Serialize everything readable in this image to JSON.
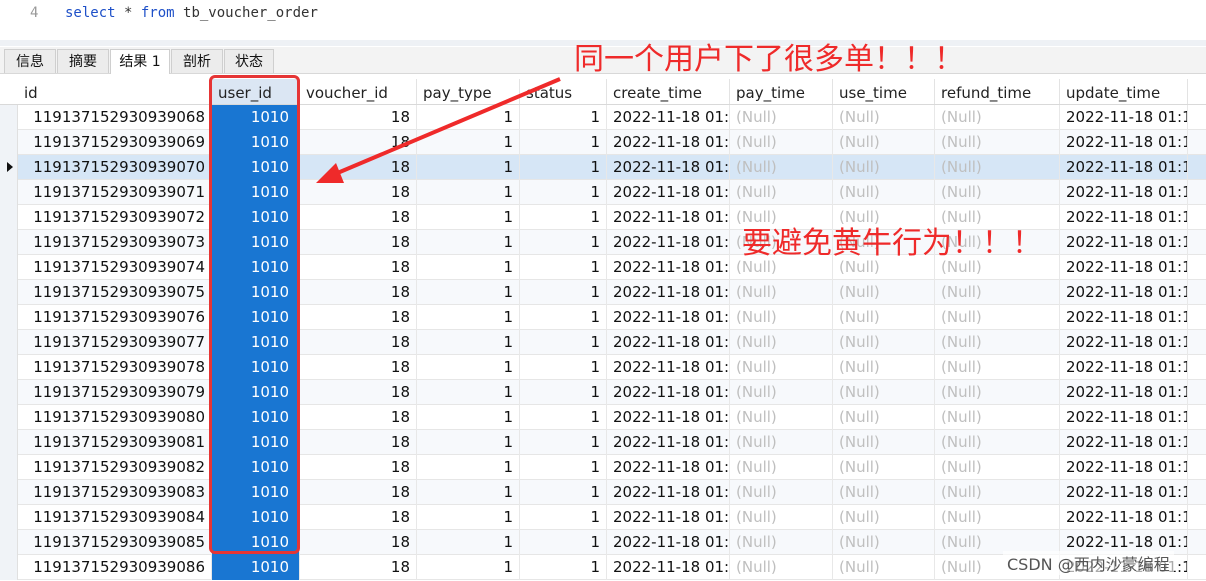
{
  "editor": {
    "line_number": "4",
    "sql_keyword_select": "select",
    "sql_star": " * ",
    "sql_keyword_from": "from",
    "sql_table": " tb_voucher_order"
  },
  "tabs": [
    {
      "label": "信息"
    },
    {
      "label": "摘要"
    },
    {
      "label": "结果 1",
      "active": true
    },
    {
      "label": "剖析"
    },
    {
      "label": "状态"
    }
  ],
  "table": {
    "columns": [
      "id",
      "user_id",
      "voucher_id",
      "pay_type",
      "status",
      "create_time",
      "pay_time",
      "use_time",
      "refund_time",
      "update_time"
    ],
    "selected_column": "user_id",
    "current_row_index": 2,
    "rows": [
      [
        "119137152930939068",
        "1010",
        "18",
        "1",
        "1",
        "2022-11-18 01:",
        "(Null)",
        "(Null)",
        "(Null)",
        "2022-11-18 01:1"
      ],
      [
        "119137152930939069",
        "1010",
        "18",
        "1",
        "1",
        "2022-11-18 01:",
        "(Null)",
        "(Null)",
        "(Null)",
        "2022-11-18 01:1"
      ],
      [
        "119137152930939070",
        "1010",
        "18",
        "1",
        "1",
        "2022-11-18 01:",
        "(Null)",
        "(Null)",
        "(Null)",
        "2022-11-18 01:1"
      ],
      [
        "119137152930939071",
        "1010",
        "18",
        "1",
        "1",
        "2022-11-18 01:",
        "(Null)",
        "(Null)",
        "(Null)",
        "2022-11-18 01:1"
      ],
      [
        "119137152930939072",
        "1010",
        "18",
        "1",
        "1",
        "2022-11-18 01:",
        "(Null)",
        "(Null)",
        "(Null)",
        "2022-11-18 01:1"
      ],
      [
        "119137152930939073",
        "1010",
        "18",
        "1",
        "1",
        "2022-11-18 01:",
        "(Null)",
        "(Null)",
        "(Null)",
        "2022-11-18 01:1"
      ],
      [
        "119137152930939074",
        "1010",
        "18",
        "1",
        "1",
        "2022-11-18 01:",
        "(Null)",
        "(Null)",
        "(Null)",
        "2022-11-18 01:1"
      ],
      [
        "119137152930939075",
        "1010",
        "18",
        "1",
        "1",
        "2022-11-18 01:",
        "(Null)",
        "(Null)",
        "(Null)",
        "2022-11-18 01:1"
      ],
      [
        "119137152930939076",
        "1010",
        "18",
        "1",
        "1",
        "2022-11-18 01:",
        "(Null)",
        "(Null)",
        "(Null)",
        "2022-11-18 01:1"
      ],
      [
        "119137152930939077",
        "1010",
        "18",
        "1",
        "1",
        "2022-11-18 01:",
        "(Null)",
        "(Null)",
        "(Null)",
        "2022-11-18 01:1"
      ],
      [
        "119137152930939078",
        "1010",
        "18",
        "1",
        "1",
        "2022-11-18 01:",
        "(Null)",
        "(Null)",
        "(Null)",
        "2022-11-18 01:1"
      ],
      [
        "119137152930939079",
        "1010",
        "18",
        "1",
        "1",
        "2022-11-18 01:",
        "(Null)",
        "(Null)",
        "(Null)",
        "2022-11-18 01:1"
      ],
      [
        "119137152930939080",
        "1010",
        "18",
        "1",
        "1",
        "2022-11-18 01:",
        "(Null)",
        "(Null)",
        "(Null)",
        "2022-11-18 01:1"
      ],
      [
        "119137152930939081",
        "1010",
        "18",
        "1",
        "1",
        "2022-11-18 01:",
        "(Null)",
        "(Null)",
        "(Null)",
        "2022-11-18 01:1"
      ],
      [
        "119137152930939082",
        "1010",
        "18",
        "1",
        "1",
        "2022-11-18 01:",
        "(Null)",
        "(Null)",
        "(Null)",
        "2022-11-18 01:1"
      ],
      [
        "119137152930939083",
        "1010",
        "18",
        "1",
        "1",
        "2022-11-18 01:",
        "(Null)",
        "(Null)",
        "(Null)",
        "2022-11-18 01:1"
      ],
      [
        "119137152930939084",
        "1010",
        "18",
        "1",
        "1",
        "2022-11-18 01:",
        "(Null)",
        "(Null)",
        "(Null)",
        "2022-11-18 01:1"
      ],
      [
        "119137152930939085",
        "1010",
        "18",
        "1",
        "1",
        "2022-11-18 01:",
        "(Null)",
        "(Null)",
        "(Null)",
        "2022-11-18 01:1"
      ],
      [
        "119137152930939086",
        "1010",
        "18",
        "1",
        "1",
        "2022-11-18 01:",
        "(Null)",
        "(Null)",
        "(Null)",
        "2022-11-18 01:1"
      ]
    ]
  },
  "annotations": {
    "top": "同一个用户下了很多单！！！",
    "middle": "要避免黄牛行为！！！"
  },
  "watermark": "CSDN @西内沙蒙编程",
  "colors": {
    "selection": "#1976d2",
    "annotation": "#ef2a2a",
    "current_row": "#d6e6f6"
  }
}
